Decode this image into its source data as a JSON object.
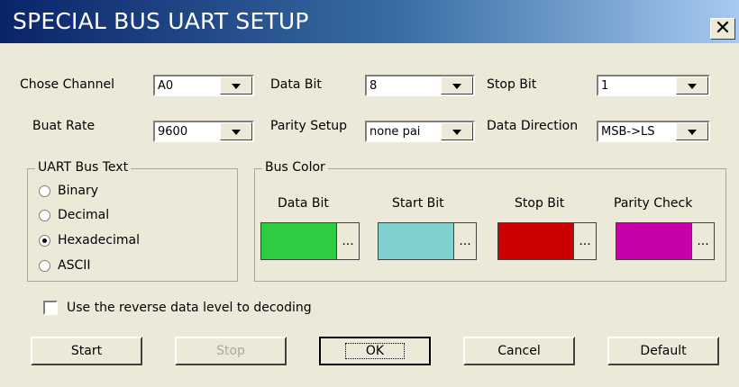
{
  "window": {
    "title": "SPECIAL BUS UART SETUP",
    "close_label": "✕"
  },
  "settings": {
    "channel": {
      "label": "Chose Channel",
      "value": "A0"
    },
    "data_bit": {
      "label": "Data Bit",
      "value": "8"
    },
    "stop_bit": {
      "label": "Stop Bit",
      "value": "1"
    },
    "baud_rate": {
      "label": "Buat Rate",
      "value": "9600"
    },
    "parity": {
      "label": "Parity Setup",
      "value": "none pai"
    },
    "direction": {
      "label": "Data Direction",
      "value": "MSB->LS"
    }
  },
  "uart_text": {
    "title": "UART Bus Text",
    "options": [
      "Binary",
      "Decimal",
      "Hexadecimal",
      "ASCII"
    ],
    "selected": "Hexadecimal"
  },
  "bus_color": {
    "title": "Bus Color",
    "items": [
      {
        "label": "Data Bit",
        "color": "#2ecc40",
        "more": "..."
      },
      {
        "label": "Start Bit",
        "color": "#7fd0cf",
        "more": "..."
      },
      {
        "label": "Stop Bit",
        "color": "#cc0000",
        "more": "..."
      },
      {
        "label": "Parity Check",
        "color": "#c800a8",
        "more": "..."
      }
    ]
  },
  "reverse_level": {
    "label": "Use the reverse data level to decoding",
    "checked": false
  },
  "buttons": {
    "start": "Start",
    "stop": "Stop",
    "ok": "OK",
    "cancel": "Cancel",
    "default": "Default"
  }
}
